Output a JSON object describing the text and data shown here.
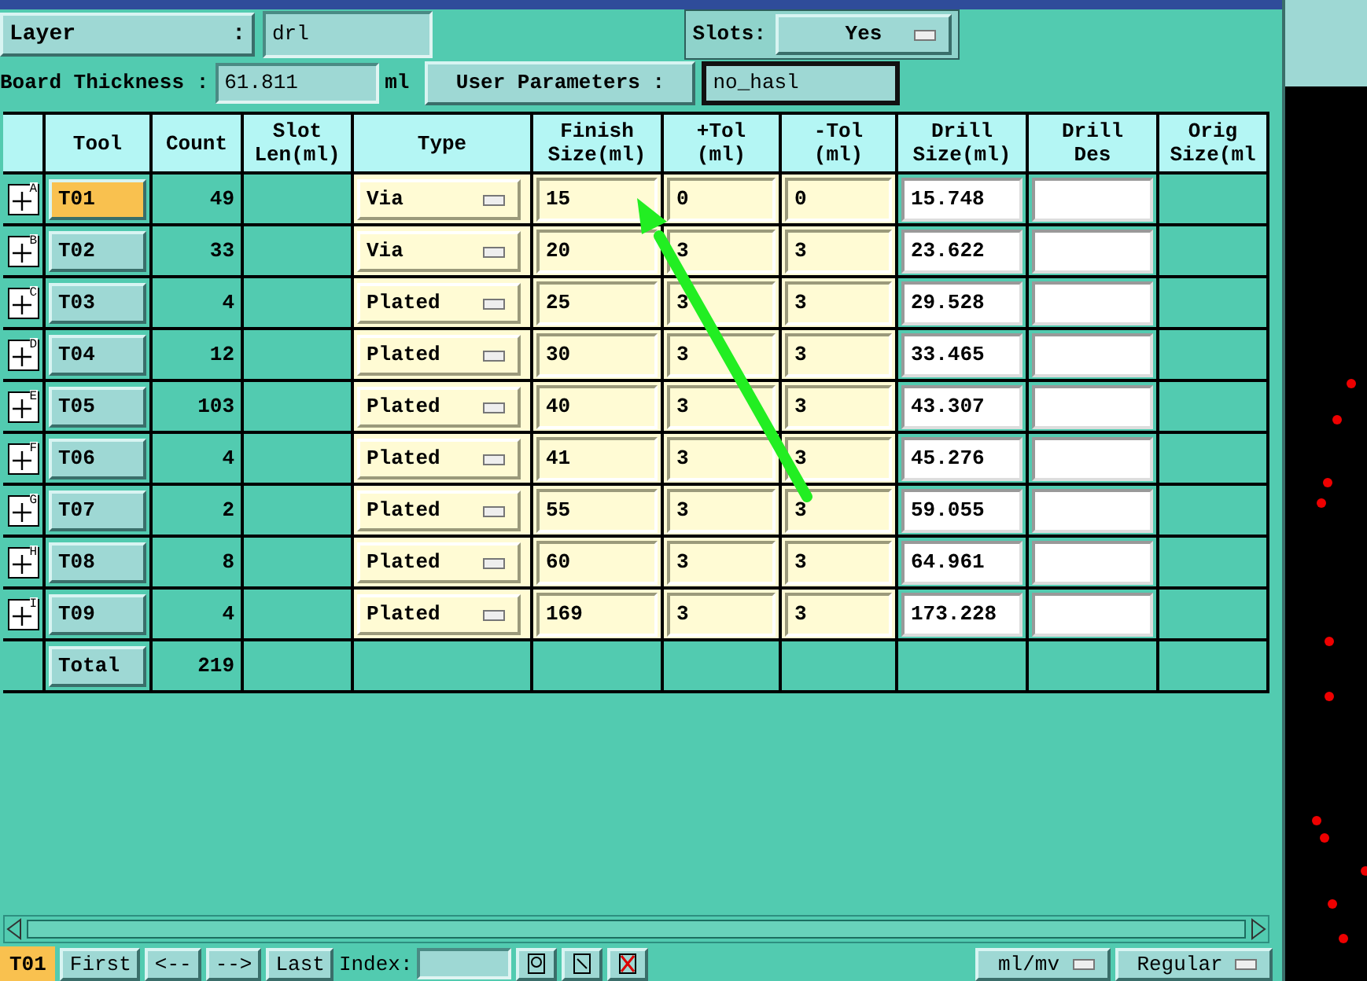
{
  "header": {
    "layer_label": "Layer",
    "layer_colon": ":",
    "layer_value": "drl",
    "slots_label": "Slots:",
    "slots_value": "Yes",
    "thickness_label": "Board Thickness :",
    "thickness_value": "61.811",
    "thickness_unit": "ml",
    "user_params_button": "User Parameters :",
    "user_params_value": "no_hasl"
  },
  "table": {
    "columns": [
      "Tool",
      "Count",
      "Slot\nLen(ml)",
      "Type",
      "Finish\nSize(ml)",
      "+Tol\n(ml)",
      "-Tol\n(ml)",
      "Drill\nSize(ml)",
      "Drill\nDes",
      "Orig\nSize(ml"
    ],
    "rows": [
      {
        "tag": "A",
        "tool": "T01",
        "selected": true,
        "count": "49",
        "type": "Via",
        "finish": "15",
        "plus_tol": "0",
        "minus_tol": "0",
        "drill_size": "15.748"
      },
      {
        "tag": "B",
        "tool": "T02",
        "selected": false,
        "count": "33",
        "type": "Via",
        "finish": "20",
        "plus_tol": "3",
        "minus_tol": "3",
        "drill_size": "23.622"
      },
      {
        "tag": "C",
        "tool": "T03",
        "selected": false,
        "count": "4",
        "type": "Plated",
        "finish": "25",
        "plus_tol": "3",
        "minus_tol": "3",
        "drill_size": "29.528"
      },
      {
        "tag": "D",
        "tool": "T04",
        "selected": false,
        "count": "12",
        "type": "Plated",
        "finish": "30",
        "plus_tol": "3",
        "minus_tol": "3",
        "drill_size": "33.465"
      },
      {
        "tag": "E",
        "tool": "T05",
        "selected": false,
        "count": "103",
        "type": "Plated",
        "finish": "40",
        "plus_tol": "3",
        "minus_tol": "3",
        "drill_size": "43.307"
      },
      {
        "tag": "F",
        "tool": "T06",
        "selected": false,
        "count": "4",
        "type": "Plated",
        "finish": "41",
        "plus_tol": "3",
        "minus_tol": "3",
        "drill_size": "45.276"
      },
      {
        "tag": "G",
        "tool": "T07",
        "selected": false,
        "count": "2",
        "type": "Plated",
        "finish": "55",
        "plus_tol": "3",
        "minus_tol": "3",
        "drill_size": "59.055"
      },
      {
        "tag": "H",
        "tool": "T08",
        "selected": false,
        "count": "8",
        "type": "Plated",
        "finish": "60",
        "plus_tol": "3",
        "minus_tol": "3",
        "drill_size": "64.961"
      },
      {
        "tag": "I",
        "tool": "T09",
        "selected": false,
        "count": "4",
        "type": "Plated",
        "finish": "169",
        "plus_tol": "3",
        "minus_tol": "3",
        "drill_size": "173.228"
      }
    ],
    "total": {
      "label": "Total",
      "count": "219"
    }
  },
  "bottom_bar": {
    "current_tool": "T01",
    "nav_buttons": [
      "First",
      "<--",
      "-->",
      "Last"
    ],
    "index_label": "Index:",
    "units": "ml/mv",
    "mode": "Regular"
  }
}
